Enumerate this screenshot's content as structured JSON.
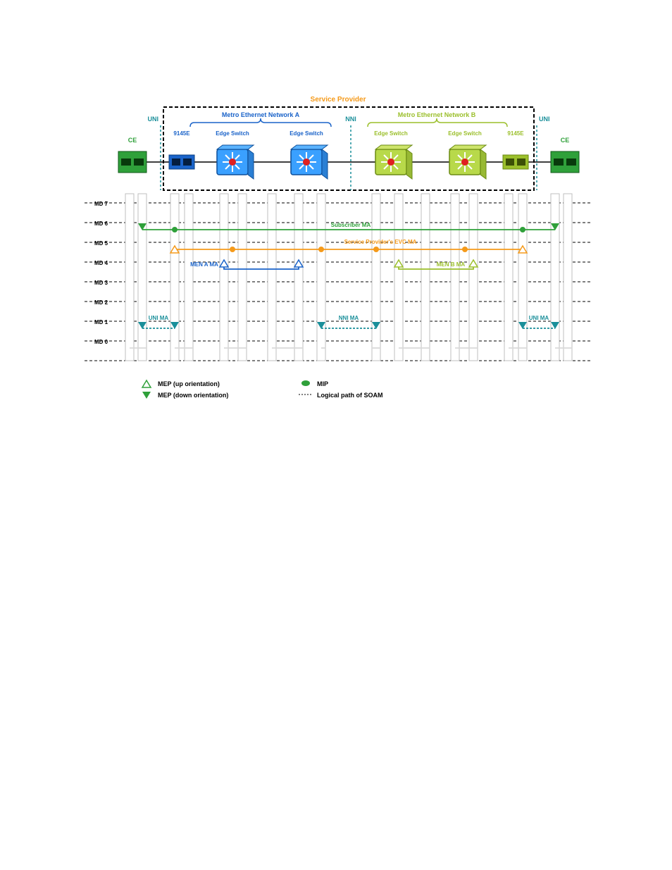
{
  "title": "Service Provider",
  "labels": {
    "uni_left": "UNI",
    "uni_right": "UNI",
    "nni": "NNI",
    "net_a": "Metro Ethernet Network A",
    "net_b": "Metro Ethernet Network B",
    "ce_left": "CE",
    "ce_right": "CE",
    "dev_9145e_a": "9145E",
    "dev_9145e_b": "9145E",
    "edge_a1": "Edge Switch",
    "edge_a2": "Edge Switch",
    "edge_b1": "Edge Switch",
    "edge_b2": "Edge Switch"
  },
  "md_rows": [
    "MD 7",
    "MD 6",
    "MD 5",
    "MD 4",
    "MD 3",
    "MD 2",
    "MD 1",
    "MD 0"
  ],
  "ma": {
    "subscriber": "Subscriber MA",
    "sp_evc": "Service Provider's EVC MA",
    "men_a": "MEN A MA",
    "men_b": "MEN B MA",
    "uni_ma_l": "UNI MA",
    "nni_ma": "NNI MA",
    "uni_ma_r": "UNI MA"
  },
  "legend": {
    "mep_up": "MEP (up orientation)",
    "mep_down": "MEP (down orientation)",
    "mip": "MIP",
    "path": "Logical path of SOAM"
  },
  "colors": {
    "green": "#2fa03a",
    "dark_green": "#2a8a33",
    "blue": "#1a63c9",
    "light_blue": "#3aa0ff",
    "orange": "#f59a1a",
    "olive": "#9bbf2b",
    "teal": "#1a8f9a",
    "grey": "#c9c9c9",
    "red": "#e02020"
  },
  "chart_data": {
    "type": "table",
    "description": "OAM Maintenance Domain (MD) level diagram for a Service Provider Metro Ethernet with two networks (A and B), CE devices, 9145E NIDs and Edge Switches. Each MA row shows MEP orientation and MIPs across device ports.",
    "md_levels": [
      7,
      6,
      5,
      4,
      3,
      2,
      1,
      0
    ],
    "devices": [
      "CE-L",
      "9145E-A",
      "EdgeSwitch-A1",
      "EdgeSwitch-A2",
      "EdgeSwitch-B1",
      "EdgeSwitch-B2",
      "9145E-B",
      "CE-R"
    ],
    "maintenance_associations": [
      {
        "name": "Subscriber MA",
        "md_level": 6,
        "color": "#2fa03a",
        "endpoints": [
          {
            "device": "CE-L",
            "mep": "down"
          },
          {
            "device": "CE-R",
            "mep": "down"
          }
        ],
        "mips": [
          "9145E-A",
          "9145E-B"
        ]
      },
      {
        "name": "Service Provider's EVC MA",
        "md_level": 5,
        "color": "#f59a1a",
        "endpoints": [
          {
            "device": "9145E-A",
            "mep": "up"
          },
          {
            "device": "9145E-B",
            "mep": "up"
          }
        ],
        "mips": [
          "EdgeSwitch-A1",
          "EdgeSwitch-A2",
          "EdgeSwitch-B1",
          "EdgeSwitch-B2"
        ]
      },
      {
        "name": "MEN A MA",
        "md_level": 4,
        "color": "#1a63c9",
        "endpoints": [
          {
            "device": "EdgeSwitch-A1",
            "mep": "up"
          },
          {
            "device": "EdgeSwitch-A2",
            "mep": "up"
          }
        ],
        "mips": []
      },
      {
        "name": "MEN B MA",
        "md_level": 4,
        "color": "#9bbf2b",
        "endpoints": [
          {
            "device": "EdgeSwitch-B1",
            "mep": "up"
          },
          {
            "device": "EdgeSwitch-B2",
            "mep": "up"
          }
        ],
        "mips": []
      },
      {
        "name": "UNI MA (left)",
        "md_level": 1,
        "color": "#1a8f9a",
        "endpoints": [
          {
            "device": "CE-L",
            "mep": "down"
          },
          {
            "device": "9145E-A",
            "mep": "down"
          }
        ],
        "mips": []
      },
      {
        "name": "NNI MA",
        "md_level": 1,
        "color": "#1a8f9a",
        "endpoints": [
          {
            "device": "EdgeSwitch-A2",
            "mep": "down"
          },
          {
            "device": "EdgeSwitch-B1",
            "mep": "down"
          }
        ],
        "mips": []
      },
      {
        "name": "UNI MA (right)",
        "md_level": 1,
        "color": "#1a8f9a",
        "endpoints": [
          {
            "device": "9145E-B",
            "mep": "down"
          },
          {
            "device": "CE-R",
            "mep": "down"
          }
        ],
        "mips": []
      }
    ]
  }
}
